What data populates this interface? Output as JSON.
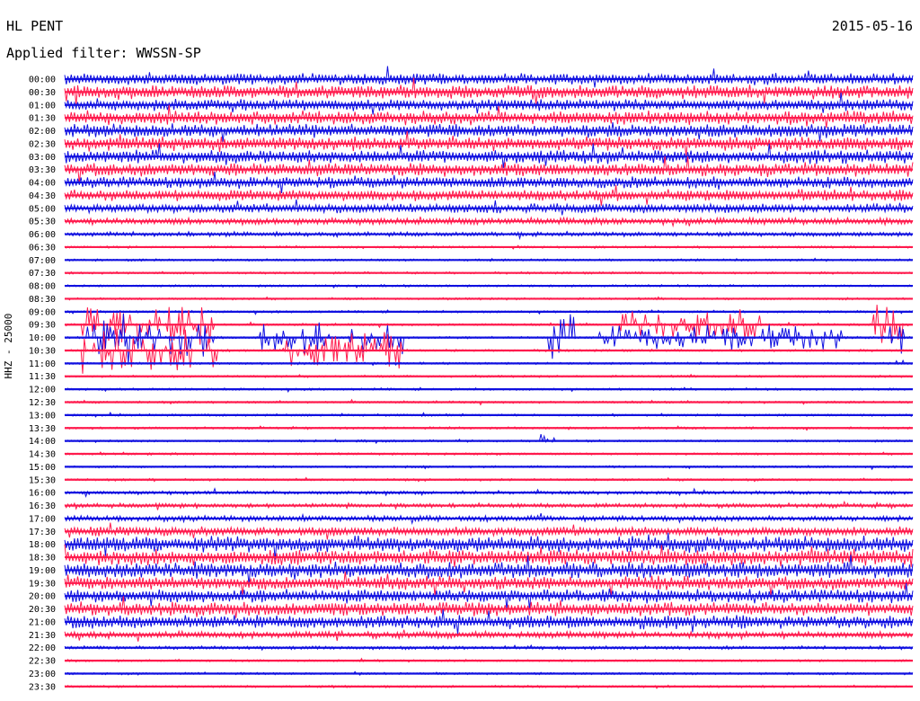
{
  "header": {
    "station": "HL PENT",
    "date": "2015-05-16",
    "filter": "Applied filter: WWSSN-SP"
  },
  "chart_data": {
    "type": "helicorder",
    "ylabel": "HHZ - 25000",
    "colors": {
      "a": "#1010e0",
      "b": "#ff1a4d"
    },
    "rows": [
      {
        "time": "00:00",
        "amp": 5
      },
      {
        "time": "00:30",
        "amp": 6
      },
      {
        "time": "01:00",
        "amp": 5
      },
      {
        "time": "01:30",
        "amp": 6
      },
      {
        "time": "02:00",
        "amp": 6
      },
      {
        "time": "02:30",
        "amp": 6
      },
      {
        "time": "03:00",
        "amp": 6
      },
      {
        "time": "03:30",
        "amp": 6
      },
      {
        "time": "04:00",
        "amp": 5
      },
      {
        "time": "04:30",
        "amp": 5
      },
      {
        "time": "05:00",
        "amp": 4
      },
      {
        "time": "05:30",
        "amp": 3
      },
      {
        "time": "06:00",
        "amp": 2
      },
      {
        "time": "06:30",
        "amp": 1
      },
      {
        "time": "07:00",
        "amp": 1
      },
      {
        "time": "07:30",
        "amp": 1
      },
      {
        "time": "08:00",
        "amp": 1
      },
      {
        "time": "08:30",
        "amp": 1
      },
      {
        "time": "09:00",
        "amp": 1
      },
      {
        "time": "09:30",
        "amp": 1
      },
      {
        "time": "10:00",
        "amp": 1
      },
      {
        "time": "10:30",
        "amp": 1
      },
      {
        "time": "11:00",
        "amp": 1
      },
      {
        "time": "11:30",
        "amp": 1
      },
      {
        "time": "12:00",
        "amp": 1
      },
      {
        "time": "12:30",
        "amp": 1
      },
      {
        "time": "13:00",
        "amp": 1
      },
      {
        "time": "13:30",
        "amp": 1
      },
      {
        "time": "14:00",
        "amp": 1
      },
      {
        "time": "14:30",
        "amp": 1
      },
      {
        "time": "15:00",
        "amp": 1
      },
      {
        "time": "15:30",
        "amp": 1
      },
      {
        "time": "16:00",
        "amp": 1.5
      },
      {
        "time": "16:30",
        "amp": 2
      },
      {
        "time": "17:00",
        "amp": 2.5
      },
      {
        "time": "17:30",
        "amp": 4
      },
      {
        "time": "18:00",
        "amp": 7
      },
      {
        "time": "18:30",
        "amp": 7
      },
      {
        "time": "19:00",
        "amp": 7
      },
      {
        "time": "19:30",
        "amp": 6
      },
      {
        "time": "20:00",
        "amp": 6
      },
      {
        "time": "20:30",
        "amp": 6
      },
      {
        "time": "21:00",
        "amp": 6
      },
      {
        "time": "21:30",
        "amp": 3
      },
      {
        "time": "22:00",
        "amp": 1.5
      },
      {
        "time": "22:30",
        "amp": 1
      },
      {
        "time": "23:00",
        "amp": 1
      },
      {
        "time": "23:30",
        "amp": 1
      }
    ],
    "events": [
      {
        "row": "09:30",
        "start": 0.02,
        "end": 0.18,
        "amp": 28
      },
      {
        "row": "10:00",
        "start": 0.02,
        "end": 0.18,
        "amp": 30
      },
      {
        "row": "10:30",
        "start": 0.02,
        "end": 0.18,
        "amp": 28
      },
      {
        "row": "10:00",
        "start": 0.23,
        "end": 0.4,
        "amp": 20
      },
      {
        "row": "10:30",
        "start": 0.26,
        "end": 0.4,
        "amp": 24
      },
      {
        "row": "10:00",
        "start": 0.57,
        "end": 0.6,
        "amp": 40
      },
      {
        "row": "10:00",
        "start": 0.63,
        "end": 0.92,
        "amp": 18
      },
      {
        "row": "09:30",
        "start": 0.65,
        "end": 0.82,
        "amp": 22
      },
      {
        "row": "09:30",
        "start": 0.95,
        "end": 0.99,
        "amp": 30
      },
      {
        "row": "10:00",
        "start": 0.96,
        "end": 0.99,
        "amp": 20
      },
      {
        "row": "11:00",
        "start": 0.97,
        "end": 0.99,
        "amp": 10
      },
      {
        "row": "14:00",
        "start": 0.56,
        "end": 0.58,
        "amp": 10
      }
    ]
  }
}
